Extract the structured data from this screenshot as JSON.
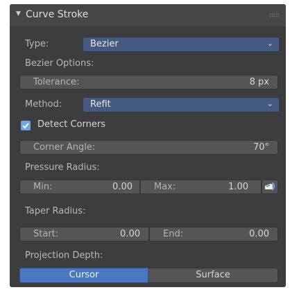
{
  "panel": {
    "title": "Curve Stroke",
    "type_label": "Type:",
    "type_value": "Bezier",
    "bezier_options_label": "Bezier Options:",
    "tolerance": {
      "label": "Tolerance:",
      "value": "8 px"
    },
    "method_label": "Method:",
    "method_value": "Refit",
    "detect_corners": {
      "label": "Detect Corners",
      "checked": true
    },
    "corner_angle": {
      "label": "Corner Angle:",
      "value": "70°"
    },
    "pressure_radius_label": "Pressure Radius:",
    "pressure_min": {
      "label": "Min:",
      "value": "0.00"
    },
    "pressure_max": {
      "label": "Max:",
      "value": "1.00"
    },
    "taper_radius_label": "Taper Radius:",
    "taper_start": {
      "label": "Start:",
      "value": "0.00"
    },
    "taper_end": {
      "label": "End:",
      "value": "0.00"
    },
    "projection_depth_label": "Projection Depth:",
    "projection_options": [
      "Cursor",
      "Surface"
    ],
    "projection_selected": "Cursor"
  },
  "icons": [
    "disclosure-triangle-icon",
    "drag-grip-icon",
    "chevron-down-icon",
    "checkmark-icon",
    "curve-picker-icon"
  ],
  "colors": {
    "panel_bg": "#3d3d3d",
    "header_bg": "#464646",
    "dropdown_bg": "#455a80",
    "field_bg": "#555555",
    "accent": "#4a78c0",
    "checkbox": "#6fa5e0"
  }
}
